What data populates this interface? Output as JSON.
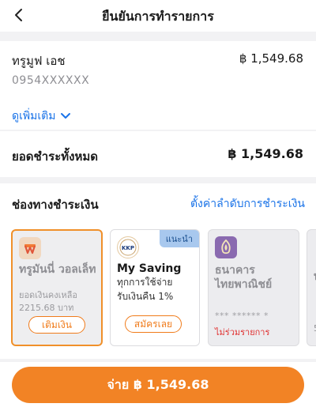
{
  "header": {
    "title": "ยืนยันการทำรายการ",
    "back_icon": "chevron-left-icon"
  },
  "summary": {
    "merchant": "ทรูมูฟ เอช",
    "amount": "฿ 1,549.68",
    "phone": "0954XXXXXX",
    "more_label": "ดูเพิ่มเติม",
    "more_icon": "chevron-down-icon"
  },
  "total": {
    "label": "ยอดชำระทั้งหมด",
    "value": "฿ 1,549.68"
  },
  "payment": {
    "heading": "ช่องทางชำระเงิน",
    "order_link": "ตั้งค่าลำดับการชำระเงิน",
    "methods": [
      {
        "name": "ทรูมันนี่ วอลเล็ท",
        "balance_label": "ยอดเงินคงเหลือ",
        "balance": "2215.68 บาท",
        "action": "เติมเงิน",
        "icon": "truemoney-wallet-icon",
        "selected": true
      },
      {
        "badge": "แนะนำ",
        "name": "My Saving",
        "desc_1": "ทุกการใช้จ่าย",
        "desc_2": "รับเงินคืน 1%",
        "action": "สมัครเลย",
        "icon": "kkp-bank-icon"
      },
      {
        "name_1": "ธนาคาร",
        "name_2": "ไทยพาณิชย์",
        "masked": "*** ****** *",
        "status": "ไม่ร่วมรายการ",
        "icon": "scb-bank-icon"
      },
      {
        "partial_text_1": "บ",
        "partial_text_2": "5"
      }
    ]
  },
  "pay_button": {
    "label": "จ่าย ฿ 1,549.68"
  },
  "colors": {
    "accent": "#f28325",
    "link": "#1a73e8",
    "error": "#e03131",
    "badge_bg": "#a8c8ee",
    "scb_purple": "#8a6ab0"
  }
}
